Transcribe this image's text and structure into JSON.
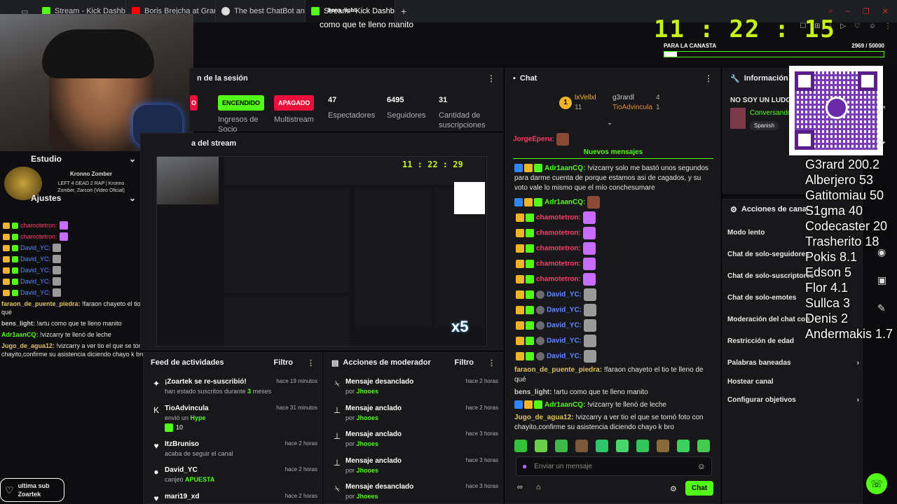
{
  "browser": {
    "tabs": [
      {
        "label": "Stream - Kick Dashboard",
        "color": "#53fc18"
      },
      {
        "label": "Boris Brejcha at Grand P...",
        "color": "#ff0000"
      },
      {
        "label": "The best ChatBot and W...",
        "color": "#dddddd"
      },
      {
        "label": "Stream - Kick Dashboard",
        "color": "#53fc18"
      }
    ],
    "new_tab": "+"
  },
  "overlay": {
    "streamer_name": "bens_light",
    "subtitle_message": "como que te lleno manito",
    "timer": {
      "h": "11",
      "m": "22",
      "s": "15"
    },
    "goal_label": "PARA LA CANASTA",
    "goal_value": "2969 / 50000",
    "goal_fraction": 0.059,
    "leaderboard": [
      "G3rard 200.2",
      "Alberjero 53",
      "Gatitomiau 50",
      "S1gma 40",
      "Codecaster 20",
      "Trasherito 18",
      "Pokis 8.1",
      "Edson 5",
      "Flor 4.1",
      "Sullca 3",
      "Denis 2",
      "Andermakis 1.7"
    ],
    "last_sub_label": "ultima sub",
    "last_sub_name": "Zoartek"
  },
  "session": {
    "title": "n de la sesión",
    "stream_section": "a del stream",
    "stats": [
      {
        "value": "ENCENDIDO",
        "label": "Ingresos de Socio",
        "kind": "green"
      },
      {
        "value": "APAGADO",
        "label": "Multistream",
        "kind": "red"
      },
      {
        "value": "47",
        "label": "Espectadores"
      },
      {
        "value": "6495",
        "label": "Seguidores"
      },
      {
        "value": "31",
        "label": "Cantidad de suscripciones"
      }
    ]
  },
  "sidebar": {
    "estudio": "Estudio",
    "ajustes": "Ajustes",
    "now_playing_title": "Kronno Zomber",
    "now_playing_sub": "LEFT 4 DEAD 2 RAP | Kronno Zomber, Zarcort (Video Oficial)",
    "mini_chat": [
      {
        "user": "chamotetron:",
        "color": "#ff3d6e"
      },
      {
        "user": "chamotetron:",
        "color": "#ff3d6e"
      },
      {
        "user": "David_YC:",
        "color": "#5b8cff"
      },
      {
        "user": "David_YC:",
        "color": "#5b8cff"
      },
      {
        "user": "David_YC:",
        "color": "#5b8cff"
      },
      {
        "user": "David_YC:",
        "color": "#5b8cff"
      },
      {
        "user": "David_YC:",
        "color": "#5b8cff"
      }
    ],
    "text_chat": [
      {
        "user": "faraon_de_puente_piedra:",
        "msg": "!faraon chayeto el tio te lleno de qué",
        "color": "#e0c25c"
      },
      {
        "user": "bens_light:",
        "msg": "!artu como que te lleno manito",
        "color": "#cfcfcf"
      },
      {
        "user": "Adr1aanCQ:",
        "msg": "!vizcarry te llenó de leche",
        "color": "#53fc18"
      },
      {
        "user": "Jugo_de_agua12:",
        "msg": "!vizcarry a ver tio el que se tomó foto con chayito,confirme su asistencia diciendo chayo k bro",
        "color": "#e0c25c"
      }
    ]
  },
  "chat": {
    "title": "Chat",
    "top_gifters": [
      {
        "name": "lxVellxl",
        "count": "11"
      },
      {
        "name": "g3rardl",
        "count": "4"
      },
      {
        "name": "TioAdvincula",
        "count": "1"
      }
    ],
    "pinned_user": "JorgeEperu:",
    "new_messages": "Nuevos mensajes",
    "messages": [
      {
        "user": "Adr1aanCQ:",
        "msg": "!vizcarry solo me bastó unos segundos para darme cuenta de porque estamos asi de cagados, y su voto vale lo mismo que el mío conchesumare",
        "color": "#53fc18"
      },
      {
        "user": "Adr1aanCQ:",
        "msg": "",
        "color": "#53fc18",
        "emote": "#8a4a36"
      },
      {
        "user": "chamotetron:",
        "msg": "",
        "color": "#ff3d6e",
        "emote": "#c76cff"
      },
      {
        "user": "chamotetron:",
        "msg": "",
        "color": "#ff3d6e",
        "emote": "#c76cff"
      },
      {
        "user": "chamotetron:",
        "msg": "",
        "color": "#ff3d6e",
        "emote": "#c76cff"
      },
      {
        "user": "chamotetron:",
        "msg": "",
        "color": "#ff3d6e",
        "emote": "#c76cff"
      },
      {
        "user": "chamotetron:",
        "msg": "",
        "color": "#ff3d6e",
        "emote": "#c76cff"
      },
      {
        "user": "David_YC:",
        "msg": "",
        "color": "#5b8cff",
        "emote": "#9a9a9a"
      },
      {
        "user": "David_YC:",
        "msg": "",
        "color": "#5b8cff",
        "emote": "#9a9a9a"
      },
      {
        "user": "David_YC:",
        "msg": "",
        "color": "#5b8cff",
        "emote": "#9a9a9a"
      },
      {
        "user": "David_YC:",
        "msg": "",
        "color": "#5b8cff",
        "emote": "#9a9a9a"
      },
      {
        "user": "David_YC:",
        "msg": "",
        "color": "#5b8cff",
        "emote": "#9a9a9a"
      },
      {
        "user": "faraon_de_puente_piedra:",
        "msg": "!faraon chayeto el tio te lleno de qué",
        "color": "#e0c25c"
      },
      {
        "user": "bens_light:",
        "msg": "!artu como que te lleno manito",
        "color": "#cfcfcf"
      },
      {
        "user": "Adr1aanCQ:",
        "msg": "!vizcarry te llenó de leche",
        "color": "#53fc18"
      },
      {
        "user": "Jugo_de_agua12:",
        "msg": "!vizcarry a ver tio el que se tomó foto con chayito,confirme su asistencia diciendo chayo k bro",
        "color": "#e0c25c"
      }
    ],
    "input_placeholder": "Enviar un mensaje",
    "send_button": "Chat"
  },
  "info": {
    "title": "Información del s",
    "not_your_label": "NO SOY UN LUDOP",
    "category": "Conversando",
    "language": "Spanish"
  },
  "mod_actions": {
    "title": "Acciones de canal",
    "items": [
      "Modo lento",
      "Chat de solo-seguidores",
      "Chat de solo-suscriptores",
      "Chat de solo-emotes",
      "Moderación del chat con",
      "Restricción de edad",
      "Palabras baneadas",
      "Hostear canal",
      "Configurar objetivos"
    ]
  },
  "feed": {
    "title": "Feed de actividades",
    "filter": "Filtro",
    "items": [
      {
        "title": "¡Zoartek se re-suscribió!",
        "sub_pre": "han estado suscritos durante ",
        "sub_hl": "3",
        "sub_post": " meses",
        "time": "hace 19 minutos"
      },
      {
        "title": "TioAdvincula",
        "sub_pre": "envió un ",
        "sub_hl": "Hype",
        "sub_post": "",
        "extra": "10",
        "time": "hace 31 minutos"
      },
      {
        "title": "ItzBruniso",
        "sub_pre": "acaba de seguir el canal",
        "sub_hl": "",
        "sub_post": "",
        "time": "hace 2 horas"
      },
      {
        "title": "David_YC",
        "sub_pre": "canjeó ",
        "sub_hl": "APUESTA",
        "sub_post": "",
        "time": "hace 2 horas"
      },
      {
        "title": "mari19_xd",
        "sub_pre": "",
        "sub_hl": "",
        "sub_post": "",
        "time": "hace 2 horas"
      }
    ]
  },
  "moderator": {
    "title": "Acciones de moderador",
    "filter": "Filtro",
    "items": [
      {
        "action": "Mensaje desanclado",
        "by": "por ",
        "mod": "Jhooes",
        "time": "hace 2 horas"
      },
      {
        "action": "Mensaje anclado",
        "by": "por ",
        "mod": "Jhooes",
        "time": "hace 2 horas"
      },
      {
        "action": "Mensaje anclado",
        "by": "por ",
        "mod": "Jhooes",
        "time": "hace 3 horas"
      },
      {
        "action": "Mensaje anclado",
        "by": "por ",
        "mod": "Jhooes",
        "time": "hace 3 horas"
      },
      {
        "action": "Mensaje desanclado",
        "by": "por ",
        "mod": "Jhoees",
        "time": "hace 3 horas"
      }
    ]
  },
  "preview": {
    "timer": "11 : 22 : 29"
  }
}
